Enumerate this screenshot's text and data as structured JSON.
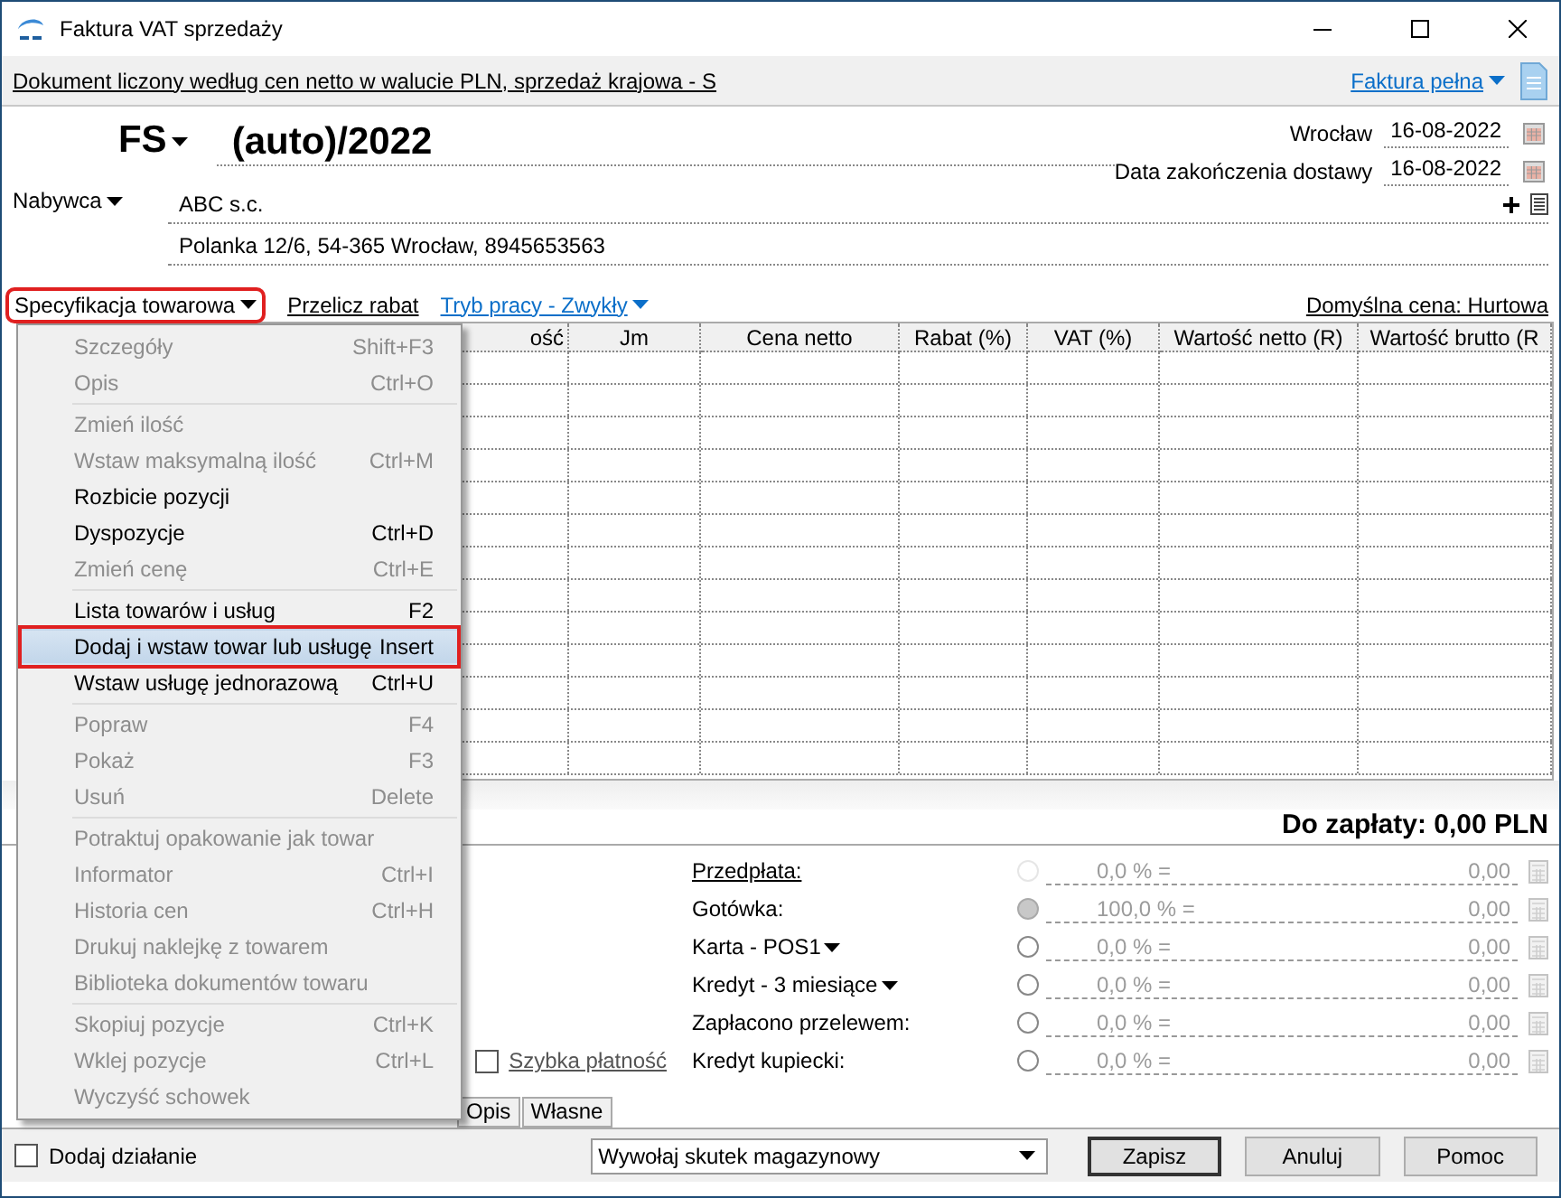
{
  "window": {
    "title": "Faktura VAT sprzedaży"
  },
  "info_bar": {
    "text": "Dokument liczony według cen netto w walucie PLN, sprzedaż krajowa - S",
    "invoice_type": "Faktura pełna"
  },
  "document": {
    "series": "FS",
    "number": "(auto)/2022",
    "place": "Wrocław",
    "issue_date": "16-08-2022",
    "delivery_label": "Data zakończenia dostawy",
    "delivery_date": "16-08-2022"
  },
  "buyer": {
    "label": "Nabywca",
    "name": "ABC s.c.",
    "address": "Polanka  12/6, 54-365 Wrocław, 8945653563"
  },
  "toolbar": {
    "spec": "Specyfikacja towarowa",
    "spec_open": true,
    "recalc": "Przelicz rabat",
    "mode": "Tryb pracy - Zwykły",
    "default_price": "Domyślna cena: Hurtowa"
  },
  "table": {
    "columns": [
      "ość",
      "Jm",
      "Cena netto",
      "Rabat (%)",
      "VAT (%)",
      "Wartość netto (R)",
      "Wartość brutto (R"
    ]
  },
  "menu": {
    "groups": [
      [
        {
          "label": "Szczegóły",
          "shortcut": "Shift+F3",
          "disabled": true,
          "selected": false
        },
        {
          "label": "Opis",
          "shortcut": "Ctrl+O",
          "disabled": true,
          "selected": false
        }
      ],
      [
        {
          "label": "Zmień ilość",
          "disabled": true,
          "selected": false
        },
        {
          "label": "Wstaw maksymalną ilość",
          "shortcut": "Ctrl+M",
          "disabled": true,
          "selected": false
        },
        {
          "label": "Rozbicie pozycji",
          "disabled": false,
          "selected": false
        },
        {
          "label": "Dyspozycje",
          "shortcut": "Ctrl+D",
          "disabled": false,
          "selected": false
        },
        {
          "label": "Zmień cenę",
          "shortcut": "Ctrl+E",
          "disabled": true,
          "selected": false
        }
      ],
      [
        {
          "label": "Lista towarów i usług",
          "shortcut": "F2",
          "disabled": false,
          "selected": false
        },
        {
          "label": "Dodaj i wstaw towar lub usługę",
          "shortcut": "Insert",
          "disabled": false,
          "selected": true
        },
        {
          "label": "Wstaw usługę jednorazową",
          "shortcut": "Ctrl+U",
          "disabled": false,
          "selected": false
        }
      ],
      [
        {
          "label": "Popraw",
          "shortcut": "F4",
          "disabled": true,
          "selected": false
        },
        {
          "label": "Pokaż",
          "shortcut": "F3",
          "disabled": true,
          "selected": false
        },
        {
          "label": "Usuń",
          "shortcut": "Delete",
          "disabled": true,
          "selected": false
        }
      ],
      [
        {
          "label": "Potraktuj opakowanie jak towar",
          "disabled": true,
          "selected": false
        },
        {
          "label": "Informator",
          "shortcut": "Ctrl+I",
          "disabled": true,
          "selected": false
        },
        {
          "label": "Historia cen",
          "shortcut": "Ctrl+H",
          "disabled": true,
          "selected": false
        },
        {
          "label": "Drukuj naklejkę z towarem",
          "disabled": true,
          "selected": false
        },
        {
          "label": "Biblioteka dokumentów towaru",
          "disabled": true,
          "selected": false
        }
      ],
      [
        {
          "label": "Skopiuj pozycje",
          "shortcut": "Ctrl+K",
          "disabled": true,
          "selected": false
        },
        {
          "label": "Wklej pozycje",
          "shortcut": "Ctrl+L",
          "disabled": true,
          "selected": false
        },
        {
          "label": "Wyczyść schowek",
          "disabled": true,
          "selected": false
        }
      ]
    ]
  },
  "total": "Do zapłaty: 0,00 PLN",
  "quick_payment": {
    "label": "Szybka płatność",
    "checked": false
  },
  "payments": [
    {
      "kind": "link",
      "label": "Przedpłata:",
      "selected": false,
      "disabled": true,
      "percent": "0,0 % =",
      "amount": "0,00"
    },
    {
      "kind": "plain",
      "label": "Gotówka:",
      "selected": true,
      "disabled": false,
      "percent": "100,0 % =",
      "amount": "0,00"
    },
    {
      "kind": "dropdown",
      "label": "Karta - POS1",
      "selected": false,
      "disabled": false,
      "percent": "0,0 % =",
      "amount": "0,00"
    },
    {
      "kind": "dropdown",
      "label": "Kredyt - 3 miesiące",
      "selected": false,
      "disabled": false,
      "percent": "0,0 % =",
      "amount": "0,00"
    },
    {
      "kind": "plain",
      "label": "Zapłacono przelewem:",
      "selected": false,
      "disabled": false,
      "percent": "0,0 % =",
      "amount": "0,00"
    },
    {
      "kind": "plain",
      "label": "Kredyt kupiecki:",
      "selected": false,
      "disabled": false,
      "percent": "0,0 % =",
      "amount": "0,00"
    }
  ],
  "tabs": [
    {
      "label": "Opis",
      "selected": false
    },
    {
      "label": "Własne",
      "selected": false
    }
  ],
  "footer": {
    "add_action": {
      "label": "Dodaj działanie",
      "checked": false
    },
    "warehouse_effect": "Wywołaj skutek magazynowy",
    "buttons": [
      "Zapisz",
      "Anuluj",
      "Pomoc"
    ]
  }
}
